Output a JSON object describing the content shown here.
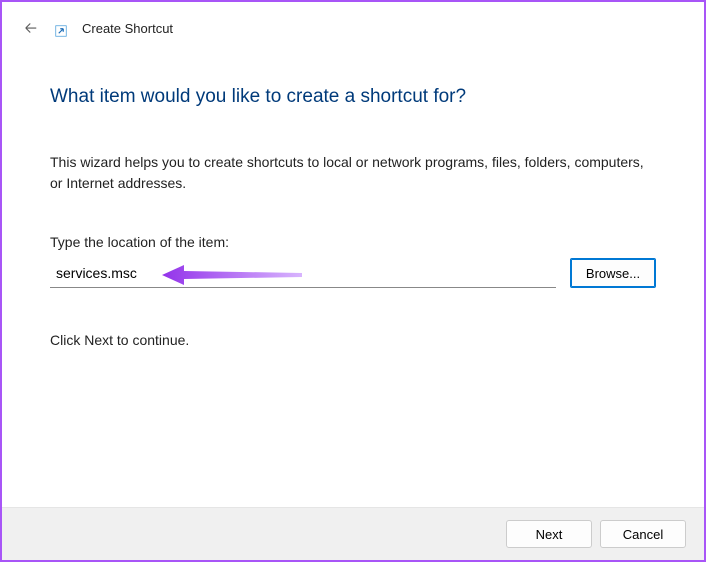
{
  "header": {
    "title": "Create Shortcut"
  },
  "main": {
    "heading": "What item would you like to create a shortcut for?",
    "description": "This wizard helps you to create shortcuts to local or network programs, files, folders, computers, or Internet addresses.",
    "field_label": "Type the location of the item:",
    "location_value": "services.msc",
    "browse_label": "Browse...",
    "continue_text": "Click Next to continue."
  },
  "footer": {
    "next_label": "Next",
    "cancel_label": "Cancel"
  }
}
